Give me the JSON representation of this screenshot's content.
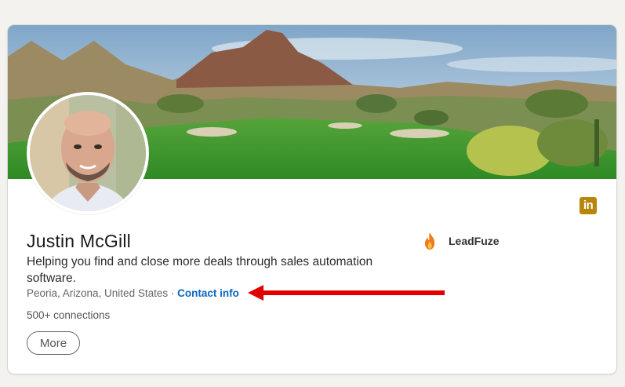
{
  "profile": {
    "name": "Justin McGill",
    "headline": "Helping you find and close more deals through sales automation software.",
    "location": "Peoria, Arizona, United States",
    "separator": " · ",
    "contact_info_label": "Contact info",
    "connections": "500+ connections",
    "more_label": "More"
  },
  "company": {
    "name": "LeadFuze",
    "icon": "flame-icon"
  },
  "badge": {
    "text": "in",
    "icon": "linkedin-icon"
  },
  "colors": {
    "background": "#f3f2ef",
    "link": "#0a66c2",
    "arrow": "#e00000",
    "flame": "#f07a16",
    "badge": "#b8860b"
  }
}
